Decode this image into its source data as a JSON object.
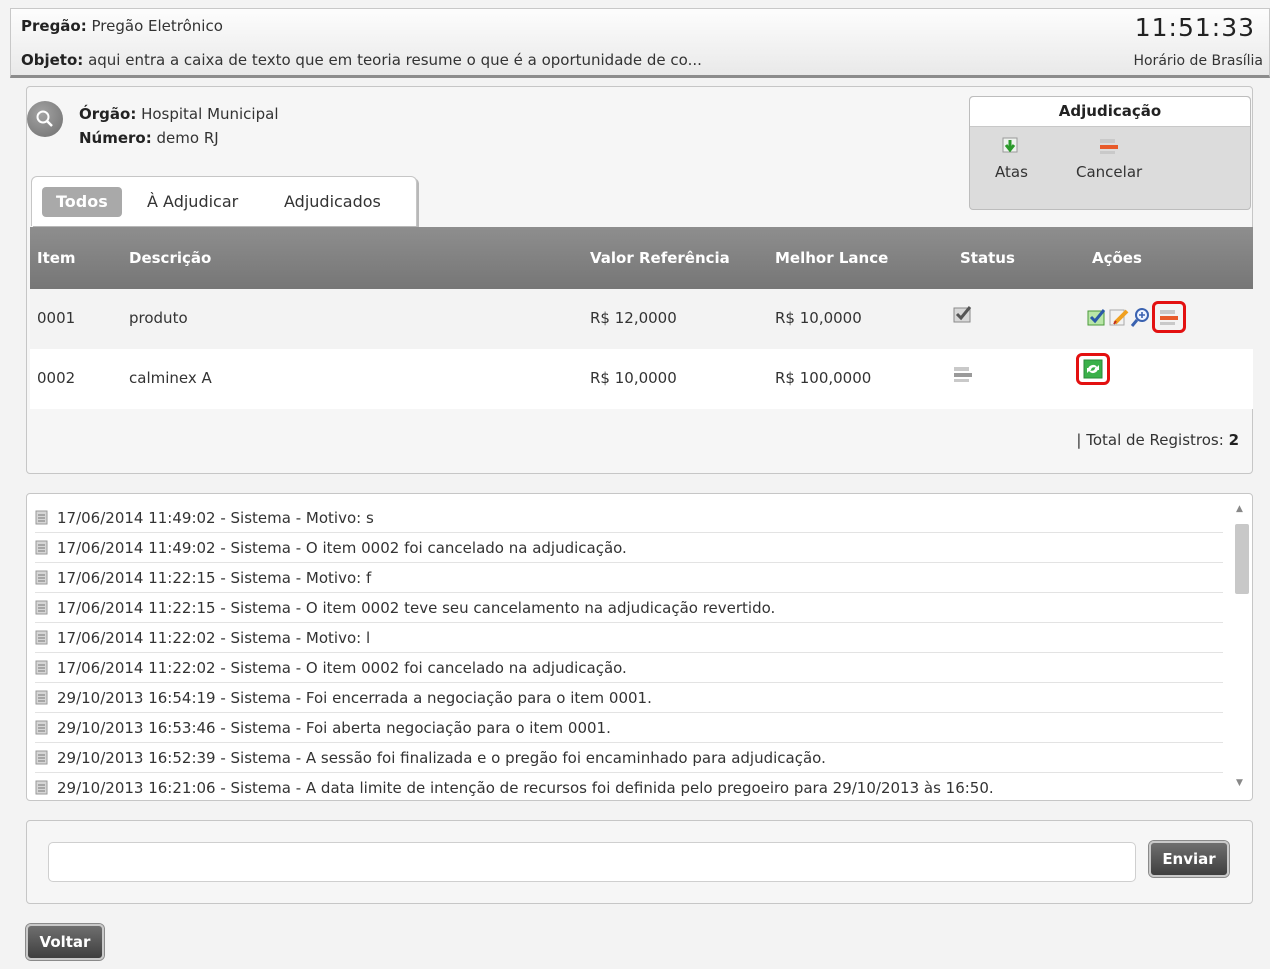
{
  "header": {
    "pregao_label": "Pregão:",
    "pregao_value": "Pregão Eletrônico",
    "objeto_label": "Objeto:",
    "objeto_value": "aqui entra a caixa de texto que em teoria resume o que é a oportunidade de co...",
    "clock": "11:51:33",
    "clock_sub": "Horário de Brasília"
  },
  "info": {
    "orgao_label": "Órgão:",
    "orgao_value": "Hospital Municipal",
    "numero_label": "Número:",
    "numero_value": "demo RJ"
  },
  "adjudicacao": {
    "title": "Adjudicação",
    "atas_label": "Atas",
    "cancelar_label": "Cancelar"
  },
  "tabs": [
    "Todos",
    "À Adjudicar",
    "Adjudicados"
  ],
  "table": {
    "headers": [
      "Item",
      "Descrição",
      "Valor Referência",
      "Melhor Lance",
      "Status",
      "Ações"
    ],
    "rows": [
      {
        "item": "0001",
        "descricao": "produto",
        "valor_referencia": "R$ 12,0000",
        "melhor_lance": "R$ 10,0000",
        "status_icon": "check-status-icon",
        "actions": [
          "adjudicate-icon",
          "edit-icon",
          "zoom-icon",
          "cancel-icon"
        ]
      },
      {
        "item": "0002",
        "descricao": "calminex A",
        "valor_referencia": "R$ 10,0000",
        "melhor_lance": "R$ 100,0000",
        "status_icon": "cancelled-status-icon",
        "actions": [
          "revert-icon"
        ]
      }
    ],
    "total_label": "| Total de Registros:",
    "total_value": "2"
  },
  "log": [
    "17/06/2014 11:49:02 - Sistema - Motivo: s",
    "17/06/2014 11:49:02 - Sistema - O item 0002 foi cancelado na adjudicação.",
    "17/06/2014 11:22:15 - Sistema - Motivo: f",
    "17/06/2014 11:22:15 - Sistema - O item 0002 teve seu cancelamento na adjudicação revertido.",
    "17/06/2014 11:22:02 - Sistema - Motivo: l",
    "17/06/2014 11:22:02 - Sistema - O item 0002 foi cancelado na adjudicação.",
    "29/10/2013 16:54:19 - Sistema - Foi encerrada a negociação para o item 0001.",
    "29/10/2013 16:53:46 - Sistema - Foi aberta negociação para o item 0001.",
    "29/10/2013 16:52:39 - Sistema - A sessão foi finalizada e o pregão foi encaminhado para adjudicação.",
    "29/10/2013 16:21:06 - Sistema - A data limite de intenção de recursos foi definida pelo pregoeiro para 29/10/2013 às 16:50."
  ],
  "message": {
    "input_value": "",
    "send_label": "Enviar"
  },
  "back_label": "Voltar",
  "colors": {
    "highlight": "#e31010",
    "header_bar": "#8c8c8c",
    "table_header": "#808080",
    "button_dark": "#4f4f4f"
  }
}
